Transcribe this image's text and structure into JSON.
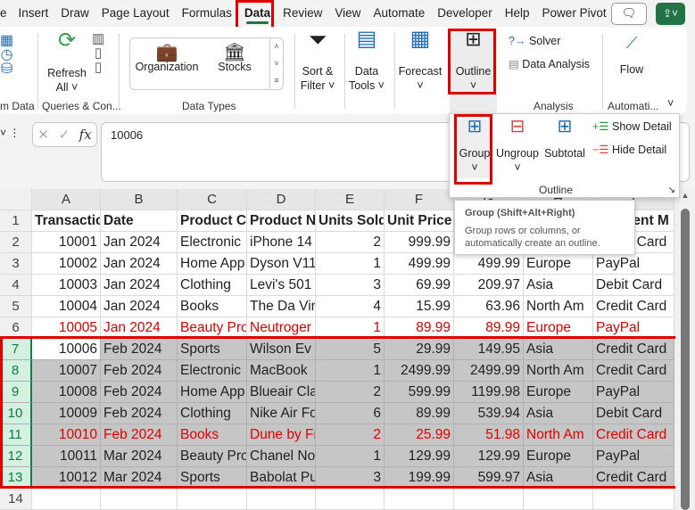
{
  "tabs": [
    "e",
    "Insert",
    "Draw",
    "Page Layout",
    "Formulas",
    "Data",
    "Review",
    "View",
    "Automate",
    "Developer",
    "Help",
    "Power Pivot"
  ],
  "active_tab": "Data",
  "ribbon": {
    "get_data_group": "m Data",
    "refresh": "Refresh",
    "refresh_all": "All",
    "queries_group": "Queries & Con...",
    "organization": "Organization",
    "stocks": "Stocks",
    "data_types_group": "Data Types",
    "sort_filter_1": "Sort &",
    "sort_filter_2": "Filter",
    "data_tools_1": "Data",
    "data_tools_2": "Tools",
    "forecast": "Forecast",
    "outline": "Outline",
    "solver": "Solver",
    "data_analysis": "Data Analysis",
    "analysis_group": "Analysis",
    "flow": "Flow",
    "automation_group": "Automati..."
  },
  "outline_panel": {
    "group": "Group",
    "ungroup": "Ungroup",
    "subtotal": "Subtotal",
    "show_detail": "Show Detail",
    "hide_detail": "Hide Detail",
    "title": "Outline"
  },
  "tooltip": {
    "title": "Group (Shift+Alt+Right)",
    "body": "Group rows or columns, or automatically create an outline."
  },
  "formula_bar": {
    "value": "10006",
    "fx": "fx"
  },
  "columns": [
    "A",
    "B",
    "C",
    "D",
    "E",
    "F",
    "G",
    "H",
    "I"
  ],
  "header_row": [
    "Transactic",
    "Date",
    "Product C",
    "Product N",
    "Units Sold",
    "Unit Price",
    "",
    "",
    "Payment M"
  ],
  "rows": [
    [
      "10001",
      "Jan 2024",
      "Electronic",
      "iPhone 14",
      "2",
      "999.99",
      "",
      "",
      "Credit Card"
    ],
    [
      "10002",
      "Jan 2024",
      "Home App",
      "Dyson V11",
      "1",
      "499.99",
      "499.99",
      "Europe",
      "PayPal"
    ],
    [
      "10003",
      "Jan 2024",
      "Clothing",
      "Levi's 501",
      "3",
      "69.99",
      "209.97",
      "Asia",
      "Debit Card"
    ],
    [
      "10004",
      "Jan 2024",
      "Books",
      "The Da Vin",
      "4",
      "15.99",
      "63.96",
      "North Am",
      "Credit Card"
    ],
    [
      "10005",
      "Jan 2024",
      "Beauty Pro",
      "Neutroger",
      "1",
      "89.99",
      "89.99",
      "Europe",
      "PayPal"
    ],
    [
      "10006",
      "Feb 2024",
      "Sports",
      "Wilson Ev",
      "5",
      "29.99",
      "149.95",
      "Asia",
      "Credit Card"
    ],
    [
      "10007",
      "Feb 2024",
      "Electronic",
      "MacBook",
      "1",
      "2499.99",
      "2499.99",
      "North Am",
      "Credit Card"
    ],
    [
      "10008",
      "Feb 2024",
      "Home App",
      "Blueair Cla",
      "2",
      "599.99",
      "1199.98",
      "Europe",
      "PayPal"
    ],
    [
      "10009",
      "Feb 2024",
      "Clothing",
      "Nike Air Fo",
      "6",
      "89.99",
      "539.94",
      "Asia",
      "Debit Card"
    ],
    [
      "10010",
      "Feb 2024",
      "Books",
      "Dune by Fr",
      "2",
      "25.99",
      "51.98",
      "North Am",
      "Credit Card"
    ],
    [
      "10011",
      "Mar 2024",
      "Beauty Pro",
      "Chanel No",
      "1",
      "129.99",
      "129.99",
      "Europe",
      "PayPal"
    ],
    [
      "10012",
      "Mar 2024",
      "Sports",
      "Babolat Pu",
      "3",
      "199.99",
      "599.97",
      "Asia",
      "Credit Card"
    ]
  ],
  "red_rows": [
    6,
    11
  ],
  "selected_rows": [
    7,
    8,
    9,
    10,
    11,
    12,
    13
  ],
  "colors": {
    "accent": "#217346",
    "highlight": "#e00000",
    "selection": "#c6c6c6"
  }
}
